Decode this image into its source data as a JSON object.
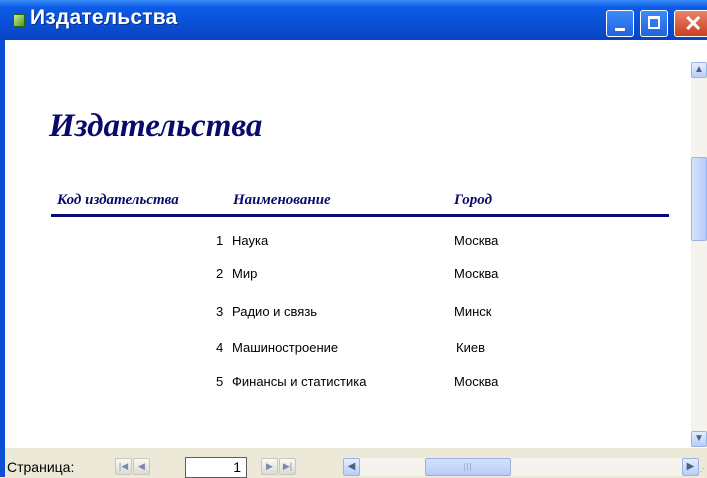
{
  "window": {
    "title": "Издательства"
  },
  "report": {
    "title": "Издательства",
    "columns": {
      "code": "Код издательства",
      "name": "Наименование",
      "city": "Город"
    },
    "rows": [
      {
        "code": "1",
        "name": "Наука",
        "city": "Москва"
      },
      {
        "code": "2",
        "name": "Мир",
        "city": "Москва"
      },
      {
        "code": "3",
        "name": "Радио и связь",
        "city": "Минск"
      },
      {
        "code": "4",
        "name": "Машиностроение",
        "city": "Киев"
      },
      {
        "code": "5",
        "name": "Финансы и статистика",
        "city": "Москва"
      }
    ]
  },
  "statusbar": {
    "page_label": "Страница:",
    "page_value": "1"
  },
  "icons": {
    "first": "first-page-icon",
    "prev": "previous-page-icon",
    "next": "next-page-icon",
    "last": "last-page-icon",
    "scroll_up": "scroll-up-icon",
    "scroll_down": "scroll-down-icon",
    "scroll_left": "scroll-left-icon",
    "scroll_right": "scroll-right-icon"
  },
  "colors": {
    "title_bar": "#0a4fd6",
    "report_text": "#0a0a6b",
    "rule": "#0a0a7a"
  }
}
